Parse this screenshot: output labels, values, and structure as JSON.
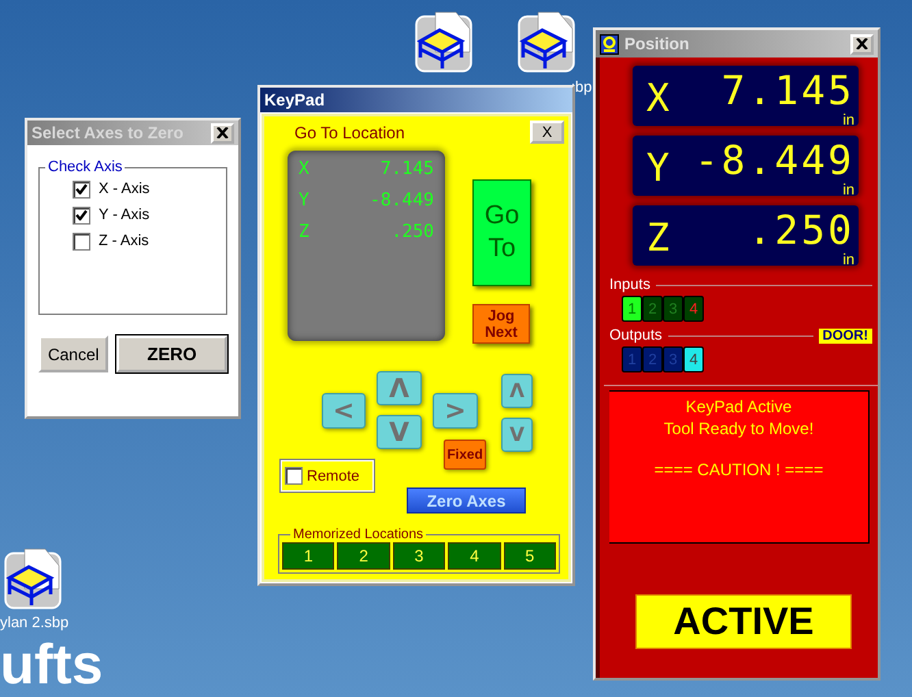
{
  "desktop": {
    "icons": [
      {
        "kind": "machine-file"
      },
      {
        "kind": "machine-file",
        "label": ":bp"
      },
      {
        "kind": "machine-file",
        "label": "ylan 2.sbp"
      }
    ],
    "wallpaper_text": "ufts"
  },
  "select_axes": {
    "title": "Select Axes to Zero",
    "group_label": "Check Axis",
    "axes": [
      {
        "label": "X - Axis",
        "checked": true
      },
      {
        "label": "Y - Axis",
        "checked": true
      },
      {
        "label": "Z - Axis",
        "checked": false
      }
    ],
    "buttons": [
      {
        "label": "Cancel",
        "default": false
      },
      {
        "label": "ZERO",
        "default": true
      }
    ]
  },
  "keypad": {
    "title": "KeyPad",
    "close_label": "X",
    "heading": "Go To Location",
    "readout": [
      {
        "axis": "X",
        "value": "7.145"
      },
      {
        "axis": "Y",
        "value": "-8.449"
      },
      {
        "axis": "Z",
        "value": ".250"
      }
    ],
    "go_button": [
      "Go",
      "To"
    ],
    "jog_button": [
      "Jog",
      "Next"
    ],
    "jog_keys": [
      {
        "kind": "left",
        "label": "<"
      },
      {
        "kind": "up",
        "label": "Λ"
      },
      {
        "kind": "down",
        "label": "V"
      },
      {
        "kind": "right",
        "label": ">"
      },
      {
        "kind": "z-up",
        "label": "Λ"
      },
      {
        "kind": "z-down",
        "label": "V"
      }
    ],
    "fixed_button": "Fixed",
    "remote": {
      "label": "Remote",
      "checked": false
    },
    "zero_button": "Zero Axes",
    "memorized": {
      "label": "Memorized Locations",
      "buttons": [
        "1",
        "2",
        "3",
        "4",
        "5"
      ]
    }
  },
  "position": {
    "title": "Position",
    "readouts": [
      {
        "axis": "X",
        "value": "7.145",
        "unit": "in"
      },
      {
        "axis": "Y",
        "value": "-8.449",
        "unit": "in"
      },
      {
        "axis": "Z",
        "value": ".250",
        "unit": "in"
      }
    ],
    "inputs": {
      "label": "Inputs",
      "leds": [
        {
          "label": "1",
          "on": true,
          "fault": false
        },
        {
          "label": "2",
          "on": false,
          "fault": false
        },
        {
          "label": "3",
          "on": false,
          "fault": false
        },
        {
          "label": "4",
          "on": false,
          "fault": true
        }
      ]
    },
    "outputs": {
      "label": "Outputs",
      "badge": "DOOR!",
      "leds": [
        {
          "label": "1",
          "on": false
        },
        {
          "label": "2",
          "on": false
        },
        {
          "label": "3",
          "on": false
        },
        {
          "label": "4",
          "on": true
        }
      ]
    },
    "message": [
      {
        "kind": "status",
        "text": "KeyPad Active"
      },
      {
        "kind": "status",
        "text": "Tool Ready to Move!"
      },
      {
        "kind": "warning",
        "text": "==== CAUTION ! ===="
      }
    ],
    "status_button": "ACTIVE"
  }
}
